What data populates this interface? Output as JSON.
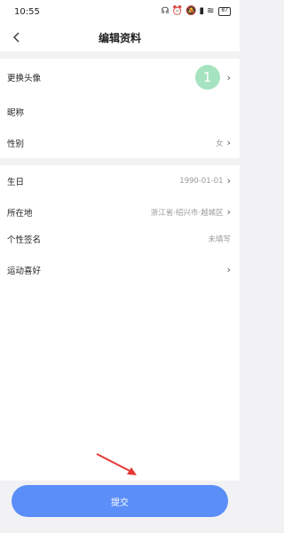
{
  "statusbar": {
    "time": "10:55",
    "battery": "87"
  },
  "header": {
    "title": "编辑资料"
  },
  "profile": {
    "avatar_label": "更换头像",
    "avatar_badge": "1",
    "nickname_label": "昵称",
    "gender_label": "性别",
    "gender_value": "女",
    "birthday_label": "生日",
    "birthday_value": "1990-01-01",
    "location_label": "所在地",
    "location_value": "浙江省·绍兴市·越城区",
    "signature_label": "个性签名",
    "signature_value": "未填写",
    "sports_label": "运动喜好"
  },
  "footer": {
    "submit_label": "提交"
  },
  "colors": {
    "accent": "#5b8ef8",
    "badge": "#a6e3c0",
    "arrow": "#e53935"
  }
}
